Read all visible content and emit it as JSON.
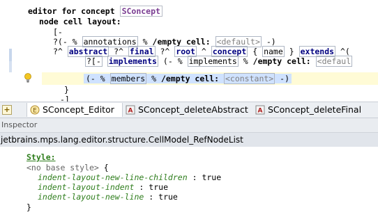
{
  "editor": {
    "header_text": "editor for concept",
    "concept_name": "SConcept",
    "layout_label": "node cell layout:",
    "l3": "[-",
    "l4": {
      "prefix": "?(- %",
      "annotations": "annotations",
      "pct": "%",
      "empty_cell": "/empty cell:",
      "default": "<default>",
      "close": "-)"
    },
    "l5": {
      "p1": "?^",
      "abstract": "abstract",
      "p2": "?^",
      "final": "final",
      "p3": "?^",
      "root": "root",
      "caret": "^",
      "concept": "concept",
      "lb": "{",
      "name": "name",
      "rb": "}",
      "extends": "extends",
      "tail": "^("
    },
    "l6": {
      "prefix": "?[-",
      "implements": "implements",
      "open": "(-",
      "pct1": "%",
      "implements_ref": "implements",
      "pct2": "%",
      "empty_cell": "/empty cell:",
      "default": "<defaul"
    },
    "l8": {
      "open": "(-",
      "pct1": "%",
      "members": "members",
      "pct2": "%",
      "empty_cell": "/empty cell:",
      "constant": "<constant>",
      "close": "-)"
    },
    "l9": "}",
    "l10": "-]"
  },
  "tabs": [
    {
      "label": "SConcept_Editor",
      "icon": "editor-icon",
      "active": true
    },
    {
      "label": "SConcept_deleteAbstract",
      "icon": "action-icon",
      "active": false
    },
    {
      "label": "SConcept_deleteFinal",
      "icon": "action-icon",
      "active": false
    }
  ],
  "inspector": {
    "title": "Inspector",
    "node_path": "jetbrains.mps.lang.editor.structure.CellModel_RefNodeList",
    "style_label": "Style:",
    "base_style": "<no base style>",
    "lbrace": "{",
    "rbrace": "}",
    "props": [
      {
        "name": "indent-layout-new-line-children",
        "sep": ":",
        "value": "true"
      },
      {
        "name": "indent-layout-indent",
        "sep": ":",
        "value": "true"
      },
      {
        "name": "indent-layout-new-line",
        "sep": ":",
        "value": "true"
      }
    ]
  },
  "colors": {
    "keyword": "#000080",
    "concept_ref": "#7a3d92",
    "style": "#2e7d1c",
    "selection": "#cfe2ff"
  }
}
